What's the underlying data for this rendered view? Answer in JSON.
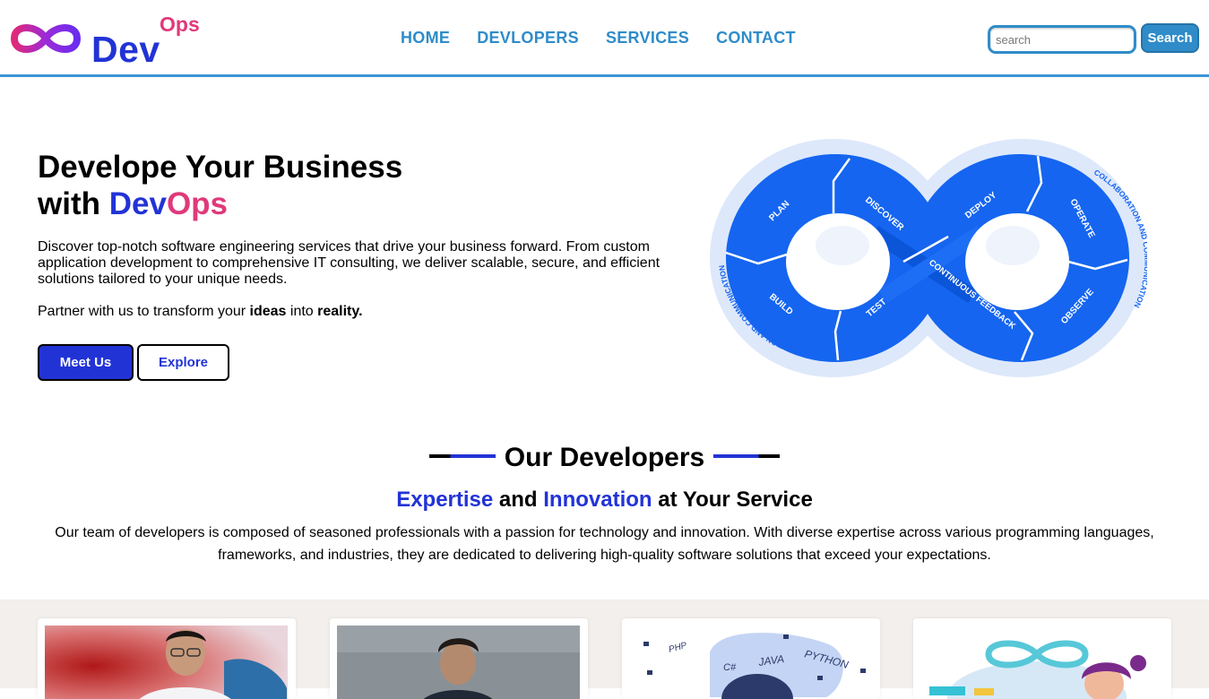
{
  "header": {
    "logo": {
      "dev": "Dev",
      "ops": "Ops"
    },
    "nav": [
      "HOME",
      "DEVLOPERS",
      "SERVICES",
      "CONTACT"
    ],
    "search": {
      "placeholder": "search",
      "button": "Search"
    }
  },
  "hero": {
    "title_line1": "Develope Your Business",
    "title_with": "with ",
    "title_dev": "Dev",
    "title_ops": "Ops",
    "description": "Discover top-notch software engineering services that drive your business forward. From custom application development to comprehensive IT consulting, we deliver scalable, secure, and efficient solutions tailored to your unique needs.",
    "partner_pre": "Partner with us to transform your ",
    "partner_b1": "ideas",
    "partner_mid": " into ",
    "partner_b2": "reality.",
    "buttons": {
      "meet": "Meet Us",
      "explore": "Explore"
    },
    "graphic": {
      "stages": [
        "PLAN",
        "DISCOVER",
        "DEPLOY",
        "OPERATE",
        "BUILD",
        "TEST",
        "CONTINUOUS FEEDBACK",
        "OBSERVE"
      ],
      "ring_label": "COLLABORATION AND COMMUNICATION",
      "colors": {
        "fill": "#1565f0",
        "ring": "#dbe7fb",
        "text": "#1565f0"
      }
    }
  },
  "developers": {
    "heading": "Our Developers",
    "sub_hl1": "Expertise",
    "sub_and": " and ",
    "sub_hl2": "Innovation",
    "sub_rest": " at Your Service",
    "paragraph": "Our team of developers is composed of seasoned professionals with a passion for technology and innovation. With diverse expertise across various programming languages, frameworks, and industries, they are dedicated to delivering high-quality software solutions that exceed your expectations.",
    "cards": [
      {
        "image": "developer-photo-1"
      },
      {
        "image": "developer-photo-2"
      },
      {
        "image": "programming-languages-illustration",
        "labels": [
          "JAVA",
          "PYTHON",
          "C#",
          "PHP"
        ]
      },
      {
        "image": "devops-illustration"
      }
    ]
  },
  "colors": {
    "accent_blue": "#2233d6",
    "accent_pink": "#e0397a",
    "nav_blue": "#2f8cc9"
  }
}
